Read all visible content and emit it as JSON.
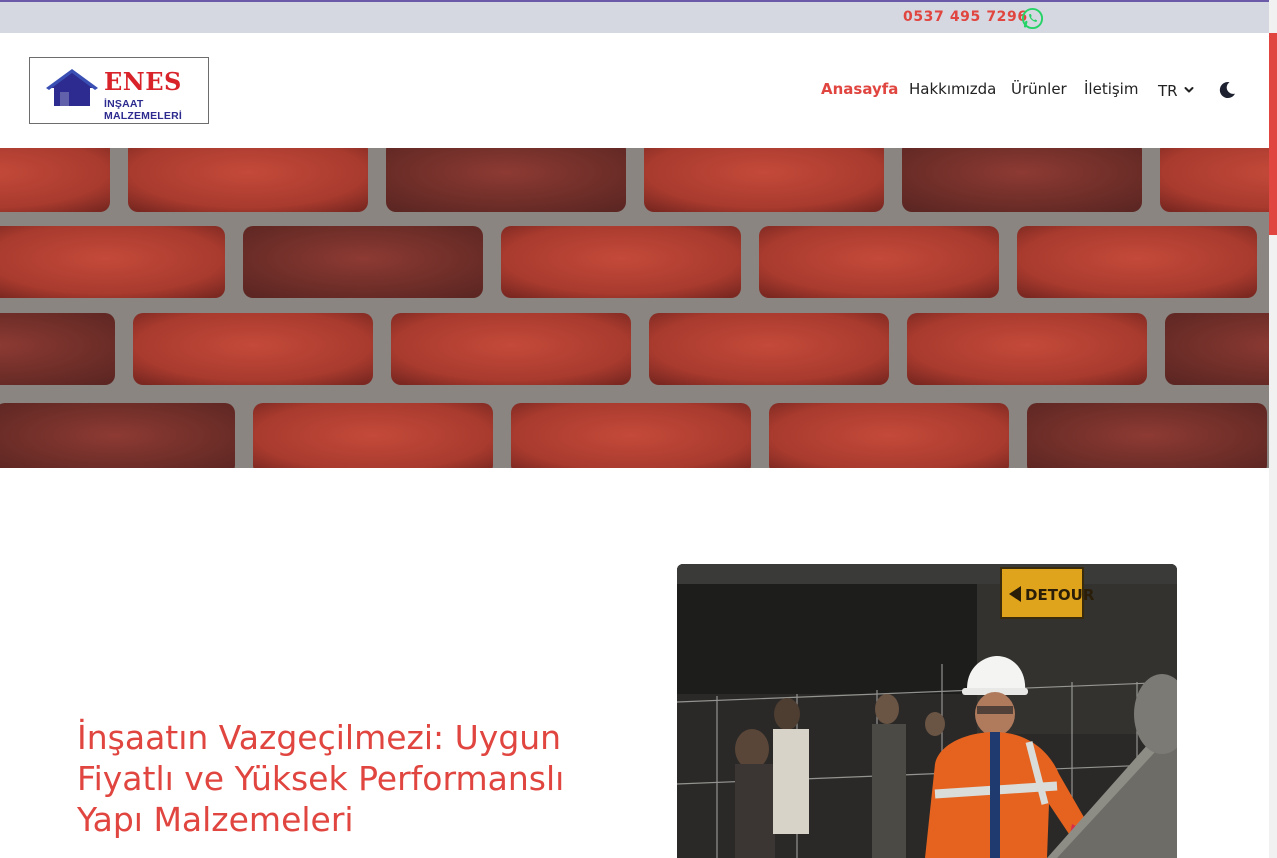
{
  "topbar": {
    "phone": "0537 495 7296",
    "whatsapp_icon": "whatsapp-icon",
    "colors": {
      "phone": "#e0453f",
      "whatsapp": "#25d366",
      "background": "#d5d8e0"
    }
  },
  "logo": {
    "title": "ENES",
    "subtitle": "İNŞAAT MALZEMELERİ",
    "icon": "house-icon"
  },
  "nav": {
    "items": [
      {
        "label": "Anasayfa",
        "active": true
      },
      {
        "label": "Hakkımızda",
        "active": false
      },
      {
        "label": "Ürünler",
        "active": false
      },
      {
        "label": "İletişim",
        "active": false
      }
    ],
    "language": "TR",
    "theme_icon": "moon-icon"
  },
  "hero": {
    "image": "brick-wall-photo"
  },
  "intro": {
    "title": "İnşaatın Vazgeçilmezi: Uygun Fiyatlı ve Yüksek Performanslı Yapı Malzemeleri",
    "image": "construction-worker-photo",
    "sign_text": "DETOUR"
  },
  "colors": {
    "accent": "#e0453f"
  }
}
